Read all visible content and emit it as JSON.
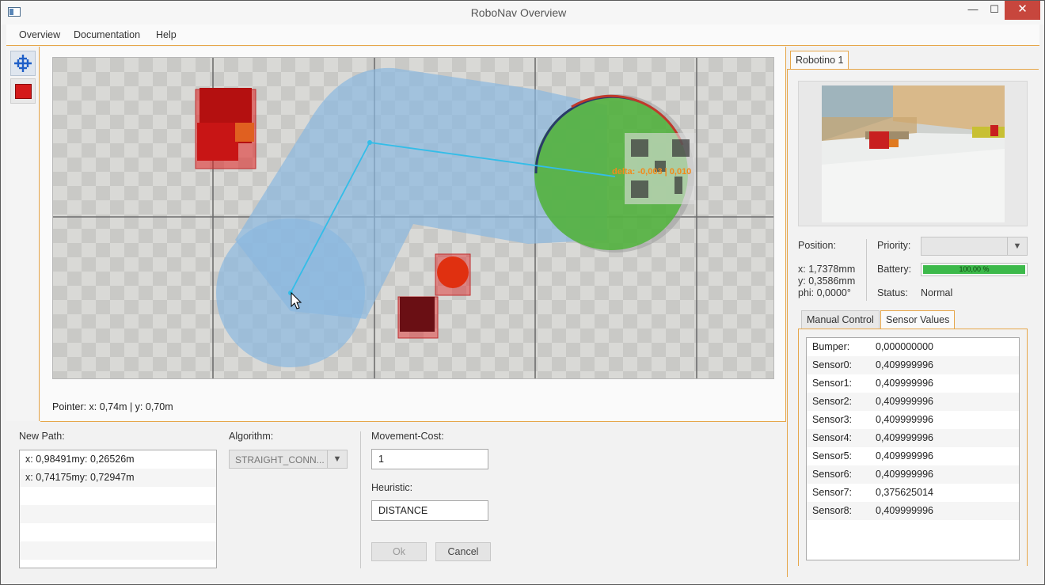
{
  "window": {
    "title": "RoboNav Overview",
    "minimize_glyph": "—",
    "maximize_glyph": "☐",
    "close_glyph": "✕"
  },
  "menu": [
    "Overview",
    "Documentation",
    "Help"
  ],
  "tools": [
    {
      "icon": "move-crosshair-icon"
    },
    {
      "icon": "red-rectangle-icon"
    }
  ],
  "map": {
    "overlay_label": "delta: -0,003 | 0,010",
    "pointer_text": "Pointer:  x: 0,74m |  y: 0,70m"
  },
  "new_path": {
    "label": "New Path:",
    "points": [
      "x: 0,98491my: 0,26526m",
      "x: 0,74175my: 0,72947m",
      "",
      "",
      "",
      ""
    ]
  },
  "algorithm": {
    "label": "Algorithm:",
    "value": "STRAIGHT_CONN..."
  },
  "movement_cost": {
    "label": "Movement-Cost:",
    "value": "1"
  },
  "heuristic": {
    "label": "Heuristic:",
    "value": "DISTANCE"
  },
  "buttons": {
    "ok": "Ok",
    "cancel": "Cancel"
  },
  "robot": {
    "tab": "Robotino 1",
    "position_label": "Position:",
    "x": "x: 1,7378mm",
    "y": "y: 0,3586mm",
    "phi": "phi: 0,0000°",
    "priority_label": "Priority:",
    "priority_value": "",
    "battery_label": "Battery:",
    "battery_text": "100,00 %",
    "battery_level": 1.0,
    "status_label": "Status:",
    "status_value": "Normal"
  },
  "subtabs": [
    "Manual Control",
    "Sensor Values"
  ],
  "sensors": [
    {
      "name": "Bumper:",
      "value": "0,000000000"
    },
    {
      "name": "Sensor0:",
      "value": "0,409999996"
    },
    {
      "name": "Sensor1:",
      "value": "0,409999996"
    },
    {
      "name": "Sensor2:",
      "value": "0,409999996"
    },
    {
      "name": "Sensor3:",
      "value": "0,409999996"
    },
    {
      "name": "Sensor4:",
      "value": "0,409999996"
    },
    {
      "name": "Sensor5:",
      "value": "0,409999996"
    },
    {
      "name": "Sensor6:",
      "value": "0,409999996"
    },
    {
      "name": "Sensor7:",
      "value": "0,375625014"
    },
    {
      "name": "Sensor8:",
      "value": "0,409999996"
    }
  ],
  "colors": {
    "accent": "#e6a64a",
    "path_line": "#33bde8",
    "reachable_area": "#8ab8e0",
    "robot_fill": "#4fb43a",
    "obstacle": "#e02020",
    "battery": "#3cb94a",
    "close_button": "#c7463d"
  }
}
